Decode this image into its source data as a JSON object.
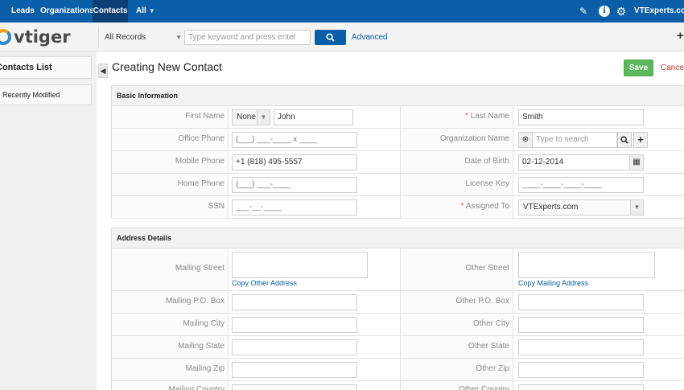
{
  "topnav": {
    "items": [
      "Leads",
      "Organizations",
      "Contacts",
      "All"
    ],
    "active": "Contacts",
    "brand": "VTExperts.com",
    "icons": [
      "pen-icon",
      "info-icon",
      "gear-icon"
    ]
  },
  "subbar": {
    "logo": "vtiger",
    "filter": "All Records",
    "search_placeholder": "Type keyword and press enter",
    "advanced": "Advanced"
  },
  "sidebar": {
    "heading": "Contacts List",
    "items": [
      "Recently Modified"
    ]
  },
  "page": {
    "title": "Creating New Contact",
    "save": "Save",
    "cancel": "Cancel"
  },
  "basic": {
    "heading": "Basic Information",
    "first_name_label": "First Name",
    "salutation": "None",
    "first_name": "John",
    "last_name_label": "Last Name",
    "last_name": "Smith",
    "office_phone_label": "Office Phone",
    "office_phone": "(___) ___-____ x ____",
    "org_name_label": "Organization Name",
    "org_placeholder": "Type to search",
    "mobile_phone_label": "Mobile Phone",
    "mobile_phone": "+1 (818) 495-5557",
    "dob_label": "Date of Birth",
    "dob": "02-12-2014",
    "home_phone_label": "Home Phone",
    "home_phone": "(___) ___-____",
    "license_key_label": "License Key",
    "license_key": "____-____-____-____",
    "ssn_label": "SSN",
    "ssn": "___-__-____",
    "assigned_to_label": "Assigned To",
    "assigned_to": "VTExperts.com"
  },
  "address": {
    "heading": "Address Details",
    "mailing_street_label": "Mailing Street",
    "other_street_label": "Other Street",
    "copy_other": "Copy Other Address",
    "copy_mailing": "Copy Mailing Address",
    "mailing_po_label": "Mailing P.O. Box",
    "other_po_label": "Other P.O. Box",
    "mailing_city_label": "Mailing City",
    "other_city_label": "Other City",
    "mailing_state_label": "Mailing State",
    "other_state_label": "Other State",
    "mailing_zip_label": "Mailing Zip",
    "other_zip_label": "Other Zip",
    "mailing_country_label": "Mailing Country",
    "other_country_label": "Other Country"
  }
}
